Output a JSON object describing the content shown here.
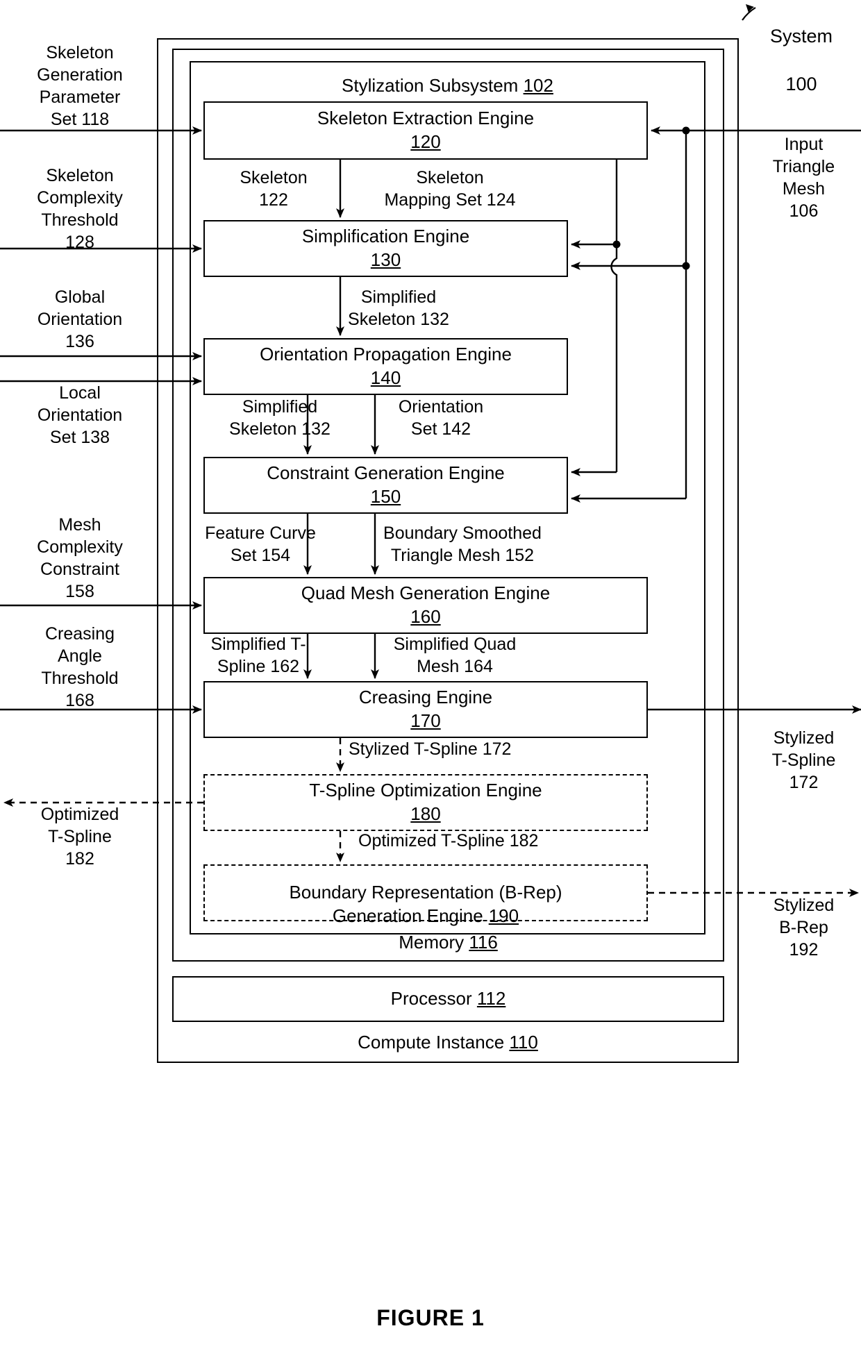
{
  "figure": {
    "caption": "FIGURE 1",
    "system_label": "System",
    "system_number": "100"
  },
  "containers": {
    "compute_instance": {
      "label": "Compute Instance",
      "number": "110"
    },
    "memory": {
      "label": "Memory",
      "number": "116"
    },
    "stylization_subsystem": {
      "label": "Stylization Subsystem",
      "number": "102"
    }
  },
  "engines": [
    {
      "name": "Skeleton Extraction Engine",
      "number": "120",
      "style": "solid"
    },
    {
      "name": "Simplification Engine",
      "number": "130",
      "style": "solid"
    },
    {
      "name": "Orientation Propagation Engine",
      "number": "140",
      "style": "solid"
    },
    {
      "name": "Constraint Generation Engine",
      "number": "150",
      "style": "solid"
    },
    {
      "name": "Quad Mesh Generation Engine",
      "number": "160",
      "style": "solid"
    },
    {
      "name": "Creasing Engine",
      "number": "170",
      "style": "solid"
    },
    {
      "name": "T-Spline Optimization Engine",
      "number": "180",
      "style": "dashed"
    },
    {
      "name": "Boundary Representation (B-Rep)\nGeneration Engine",
      "number": "190",
      "style": "dashed"
    }
  ],
  "processor": {
    "label": "Processor",
    "number": "112"
  },
  "inputs_left": [
    {
      "text": "Skeleton\nGeneration\nParameter\nSet 118"
    },
    {
      "text": "Skeleton\nComplexity\nThreshold\n128"
    },
    {
      "text": "Global\nOrientation\n136"
    },
    {
      "text": "Local\nOrientation\nSet 138"
    },
    {
      "text": "Mesh\nComplexity\nConstraint\n158"
    },
    {
      "text": "Creasing\nAngle\nThreshold\n168"
    }
  ],
  "outputs_left": [
    {
      "text": "Optimized\nT-Spline\n182"
    }
  ],
  "inputs_right": [
    {
      "text": "Input\nTriangle\nMesh\n106"
    }
  ],
  "outputs_right": [
    {
      "text": "Stylized\nT-Spline\n172"
    },
    {
      "text": "Stylized\nB-Rep\n192"
    }
  ],
  "edge_labels": [
    {
      "text": "Skeleton\n122"
    },
    {
      "text": "Skeleton\nMapping Set 124"
    },
    {
      "text": "Simplified\nSkeleton 132"
    },
    {
      "text": "Simplified\nSkeleton 132"
    },
    {
      "text": "Orientation\nSet 142"
    },
    {
      "text": "Feature Curve\nSet 154"
    },
    {
      "text": "Boundary Smoothed\nTriangle Mesh 152"
    },
    {
      "text": "Simplified T-\nSpline 162"
    },
    {
      "text": "Simplified Quad\nMesh 164"
    },
    {
      "text": "Stylized T-Spline 172"
    },
    {
      "text": "Optimized T-Spline 182"
    }
  ]
}
